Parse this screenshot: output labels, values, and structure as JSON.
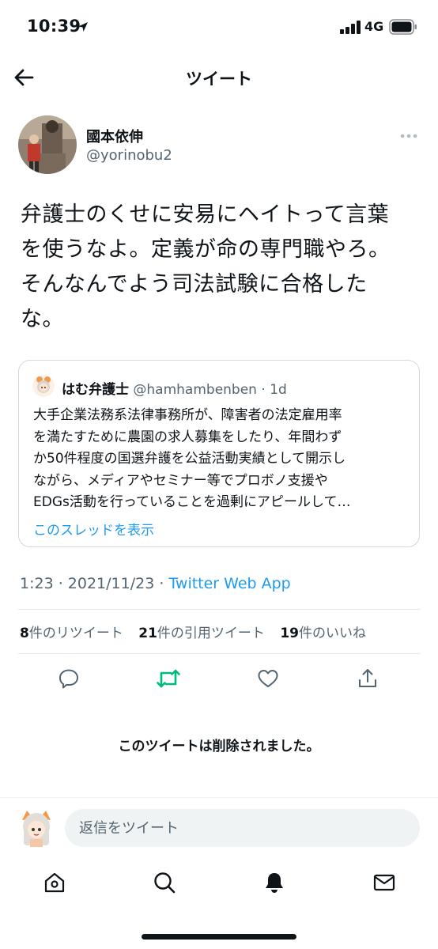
{
  "status_bar": {
    "time": "10:39",
    "network": "4G"
  },
  "header": {
    "title": "ツイート"
  },
  "author": {
    "name": "國本依伸",
    "handle": "@yorinobu2"
  },
  "tweet": {
    "lines": [
      "弁護士のくせに安易にヘイトって言葉",
      "を使うなよ。定義が命の専門職やろ。",
      "そんなんでよう司法試験に合格した",
      "な。"
    ]
  },
  "quote": {
    "name": "はむ弁護士",
    "handle": "@hamhambenben",
    "separator": " · ",
    "time": "1d",
    "lines": [
      "大手企業法務系法律事務所が、障害者の法定雇用率",
      "を満たすために農園の求人募集をしたり、年間わず",
      "か50件程度の国選弁護を公益活動実績として開示し",
      "ながら、メディアやセミナー等でプロボノ支援や",
      "EDGs活動を行っていることを過剰にアピールして…"
    ],
    "show_thread": "このスレッドを表示"
  },
  "meta": {
    "time": "1:23",
    "separator": " · ",
    "date": "2021/11/23",
    "app": "Twitter Web App"
  },
  "stats": {
    "retweets_count": "8",
    "retweets_label": "件のリツイート",
    "quotes_count": "21",
    "quotes_label": "件の引用ツイート",
    "likes_count": "19",
    "likes_label": "件のいいね"
  },
  "deleted_notice": "このツイートは削除されました。",
  "reply": {
    "placeholder": "返信をツイート"
  },
  "colors": {
    "accent": "#1d9bf0",
    "retweet_green": "#00ba7c",
    "text": "#0f1419",
    "secondary": "#536471"
  }
}
